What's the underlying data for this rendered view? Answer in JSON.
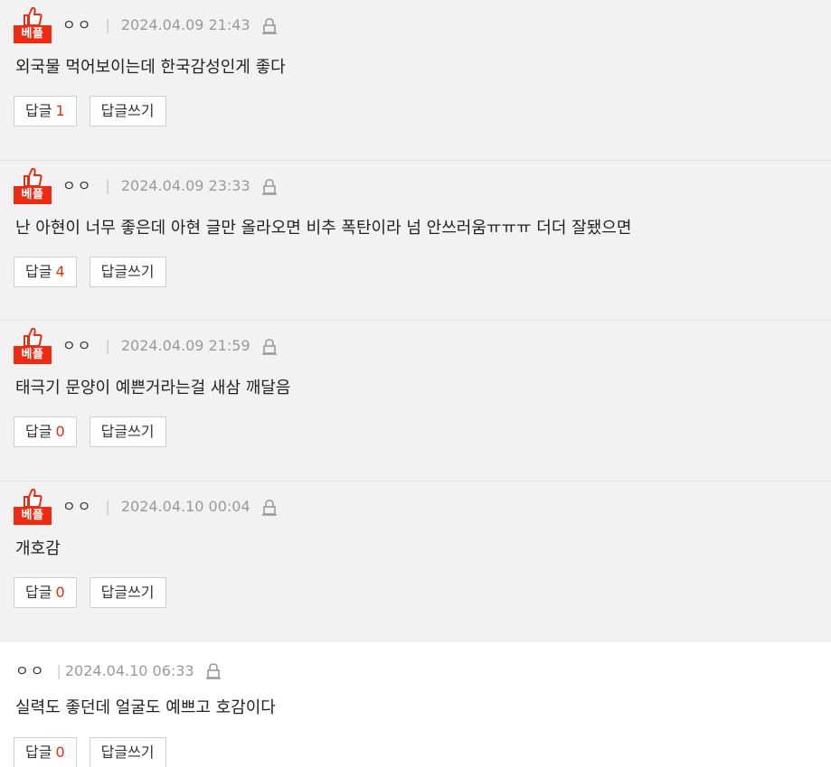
{
  "badge_label": "베플",
  "reply_label": "답글",
  "write_reply_label": "답글쓰기",
  "separator": "|",
  "comments": [
    {
      "nick": "ㅇㅇ",
      "date": "2024.04.09 21:43",
      "text": "외국물 먹어보이는데 한국감성인게 좋다",
      "reply_count": "1",
      "best": true
    },
    {
      "nick": "ㅇㅇ",
      "date": "2024.04.09 23:33",
      "text": "난 아현이 너무 좋은데 아현 글만 올라오면 비추 폭탄이라 넘 안쓰러움ㅠㅠㅠ 더더 잘됐으면",
      "reply_count": "4",
      "best": true
    },
    {
      "nick": "ㅇㅇ",
      "date": "2024.04.09 21:59",
      "text": "태극기 문양이 예쁜거라는걸 새삼 깨달음",
      "reply_count": "0",
      "best": true
    },
    {
      "nick": "ㅇㅇ",
      "date": "2024.04.10 00:04",
      "text": "개호감",
      "reply_count": "0",
      "best": true
    },
    {
      "nick": "ㅇㅇ",
      "date": "2024.04.10 06:33",
      "text": "실력도 좋던데 얼굴도 예쁘고 호감이다",
      "reply_count": "0",
      "best": false
    }
  ],
  "colors": {
    "badge_red": "#ee2b12",
    "count_red": "#e03010",
    "best_bg": "#f2f2f2"
  }
}
